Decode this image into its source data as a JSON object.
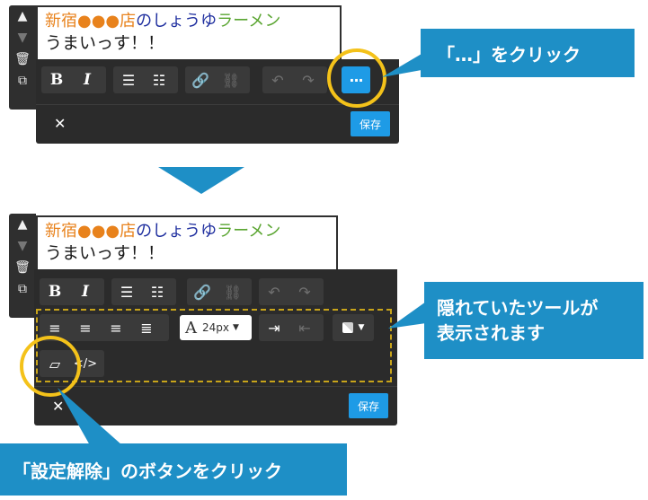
{
  "editor_text": {
    "line1_segments": [
      {
        "text": "新宿●●●店",
        "color": "orange"
      },
      {
        "text": "のしょうゆ",
        "color": "blue"
      },
      {
        "text": "ラーメン",
        "color": "green"
      }
    ],
    "line2": "うまいっす！！"
  },
  "toolbar": {
    "bold": "B",
    "italic": "I",
    "more_label": "···",
    "close_label": "✕",
    "save_label": "保存"
  },
  "expanded_tools": {
    "font_size_label": "24px"
  },
  "callouts": {
    "top": "「…」をクリック",
    "middle": "隠れていたツールが\n表示されます",
    "bottom": "「設定解除」のボタンをクリック"
  },
  "colors": {
    "accent_blue": "#1e9be6",
    "callout_blue": "#1e8fc6",
    "highlight_yellow": "#f4c21a",
    "toolbar_dark": "#2b2b2b"
  }
}
